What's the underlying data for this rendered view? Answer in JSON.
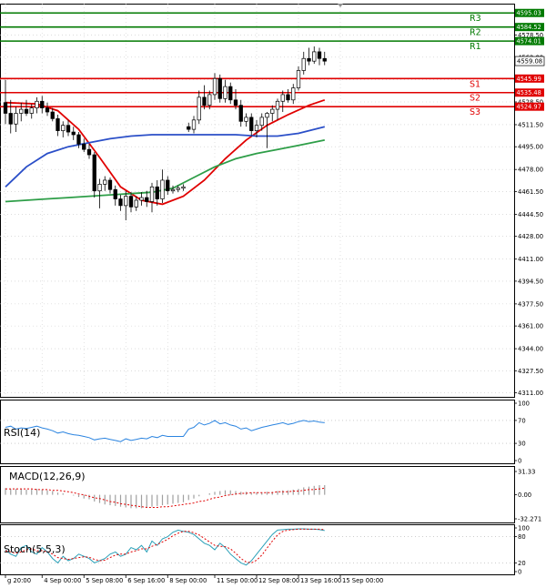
{
  "chart_data": {
    "type": "candlestick",
    "symbol": "",
    "grid": true,
    "price_axis": {
      "ylim": [
        4308,
        4602
      ],
      "ticks": [
        4311.0,
        4327.5,
        4344.0,
        4361.0,
        4377.5,
        4394.5,
        4411.0,
        4428.0,
        4444.5,
        4461.5,
        4478.0,
        4495.0,
        4511.5,
        4528.5,
        4545.0,
        4562.0,
        4578.5,
        4595.0
      ],
      "tick_labels": [
        "4311.00",
        "4327.50",
        "4344.00",
        "4361.00",
        "4377.50",
        "4394.50",
        "4411.00",
        "4428.00",
        "4444.50",
        "4461.50",
        "4478.00",
        "4495.00",
        "4511.50",
        "4528.50",
        "4545.00",
        "4562.00",
        "4578.50",
        "4595.00"
      ]
    },
    "time_axis": {
      "labels": [
        "g 20:00",
        "4 Sep 00:00",
        "5 Sep 08:00",
        "6 Sep 16:00",
        "8 Sep 00:00",
        "11 Sep 00:00",
        "12 Sep 08:00",
        "13 Sep 16:00",
        "15 Sep 00:00"
      ],
      "label_bars": [
        0,
        7,
        15,
        23,
        31,
        40,
        48,
        56,
        64
      ]
    },
    "levels": [
      {
        "name": "R3",
        "value": 4595.03,
        "label": "4595.03",
        "color": "#007a00"
      },
      {
        "name": "R2",
        "value": 4584.52,
        "label": "4584.52",
        "color": "#007a00"
      },
      {
        "name": "R1",
        "value": 4574.01,
        "label": "4574.01",
        "color": "#007a00"
      },
      {
        "name": "S1",
        "value": 4545.99,
        "label": "4545.99",
        "color": "#e00000"
      },
      {
        "name": "S2",
        "value": 4535.48,
        "label": "4535.48",
        "color": "#e00000"
      },
      {
        "name": "S3",
        "value": 4524.97,
        "label": "4524.97",
        "color": "#e00000"
      }
    ],
    "current_price": {
      "value": 4559.08,
      "label": "4559.08"
    },
    "candles": [
      {
        "o": 4528,
        "h": 4545,
        "l": 4512,
        "c": 4520
      },
      {
        "o": 4520,
        "h": 4530,
        "l": 4505,
        "c": 4512
      },
      {
        "o": 4512,
        "h": 4525,
        "l": 4506,
        "c": 4520
      },
      {
        "o": 4520,
        "h": 4528,
        "l": 4514,
        "c": 4523
      },
      {
        "o": 4523,
        "h": 4530,
        "l": 4518,
        "c": 4520
      },
      {
        "o": 4520,
        "h": 4527,
        "l": 4516,
        "c": 4524
      },
      {
        "o": 4524,
        "h": 4532,
        "l": 4520,
        "c": 4529
      },
      {
        "o": 4529,
        "h": 4533,
        "l": 4520,
        "c": 4524
      },
      {
        "o": 4524,
        "h": 4528,
        "l": 4518,
        "c": 4521
      },
      {
        "o": 4521,
        "h": 4524,
        "l": 4514,
        "c": 4516
      },
      {
        "o": 4516,
        "h": 4519,
        "l": 4503,
        "c": 4507
      },
      {
        "o": 4507,
        "h": 4514,
        "l": 4502,
        "c": 4511
      },
      {
        "o": 4511,
        "h": 4515,
        "l": 4503,
        "c": 4506
      },
      {
        "o": 4506,
        "h": 4510,
        "l": 4500,
        "c": 4504
      },
      {
        "o": 4504,
        "h": 4506,
        "l": 4494,
        "c": 4497
      },
      {
        "o": 4497,
        "h": 4501,
        "l": 4491,
        "c": 4493
      },
      {
        "o": 4493,
        "h": 4497,
        "l": 4486,
        "c": 4489
      },
      {
        "o": 4489,
        "h": 4491,
        "l": 4457,
        "c": 4462
      },
      {
        "o": 4462,
        "h": 4471,
        "l": 4449,
        "c": 4467
      },
      {
        "o": 4467,
        "h": 4473,
        "l": 4462,
        "c": 4470
      },
      {
        "o": 4470,
        "h": 4472,
        "l": 4460,
        "c": 4463
      },
      {
        "o": 4463,
        "h": 4466,
        "l": 4451,
        "c": 4456
      },
      {
        "o": 4456,
        "h": 4459,
        "l": 4447,
        "c": 4451
      },
      {
        "o": 4451,
        "h": 4462,
        "l": 4440,
        "c": 4458
      },
      {
        "o": 4458,
        "h": 4461,
        "l": 4446,
        "c": 4450
      },
      {
        "o": 4450,
        "h": 4458,
        "l": 4447,
        "c": 4455
      },
      {
        "o": 4455,
        "h": 4461,
        "l": 4451,
        "c": 4457
      },
      {
        "o": 4457,
        "h": 4462,
        "l": 4450,
        "c": 4454
      },
      {
        "o": 4454,
        "h": 4468,
        "l": 4446,
        "c": 4465
      },
      {
        "o": 4465,
        "h": 4470,
        "l": 4451,
        "c": 4456
      },
      {
        "o": 4456,
        "h": 4478,
        "l": 4453,
        "c": 4470
      },
      {
        "o": 4470,
        "h": 4473,
        "l": 4459,
        "c": 4462
      },
      {
        "o": 4462,
        "h": 4466,
        "l": 4460,
        "c": 4463
      },
      {
        "o": 4463,
        "h": 4466,
        "l": 4461,
        "c": 4464
      },
      {
        "o": 4464,
        "h": 4467,
        "l": 4462,
        "c": 4465
      },
      {
        "o": 4510,
        "h": 4513,
        "l": 4506,
        "c": 4508
      },
      {
        "o": 4508,
        "h": 4518,
        "l": 4505,
        "c": 4515
      },
      {
        "o": 4515,
        "h": 4537,
        "l": 4512,
        "c": 4532
      },
      {
        "o": 4532,
        "h": 4541,
        "l": 4523,
        "c": 4526
      },
      {
        "o": 4526,
        "h": 4537,
        "l": 4523,
        "c": 4534
      },
      {
        "o": 4534,
        "h": 4550,
        "l": 4530,
        "c": 4546
      },
      {
        "o": 4546,
        "h": 4549,
        "l": 4528,
        "c": 4531
      },
      {
        "o": 4531,
        "h": 4545,
        "l": 4528,
        "c": 4540
      },
      {
        "o": 4540,
        "h": 4543,
        "l": 4527,
        "c": 4530
      },
      {
        "o": 4530,
        "h": 4538,
        "l": 4523,
        "c": 4526
      },
      {
        "o": 4526,
        "h": 4530,
        "l": 4510,
        "c": 4514
      },
      {
        "o": 4514,
        "h": 4520,
        "l": 4510,
        "c": 4517
      },
      {
        "o": 4517,
        "h": 4520,
        "l": 4503,
        "c": 4507
      },
      {
        "o": 4507,
        "h": 4515,
        "l": 4502,
        "c": 4511
      },
      {
        "o": 4511,
        "h": 4520,
        "l": 4507,
        "c": 4517
      },
      {
        "o": 4517,
        "h": 4521,
        "l": 4494,
        "c": 4520
      },
      {
        "o": 4520,
        "h": 4526,
        "l": 4514,
        "c": 4523
      },
      {
        "o": 4523,
        "h": 4531,
        "l": 4515,
        "c": 4529
      },
      {
        "o": 4529,
        "h": 4537,
        "l": 4521,
        "c": 4534
      },
      {
        "o": 4534,
        "h": 4538,
        "l": 4528,
        "c": 4530
      },
      {
        "o": 4530,
        "h": 4542,
        "l": 4527,
        "c": 4539
      },
      {
        "o": 4539,
        "h": 4555,
        "l": 4537,
        "c": 4552
      },
      {
        "o": 4552,
        "h": 4566,
        "l": 4549,
        "c": 4561
      },
      {
        "o": 4561,
        "h": 4569,
        "l": 4556,
        "c": 4559
      },
      {
        "o": 4559,
        "h": 4570,
        "l": 4557,
        "c": 4566
      },
      {
        "o": 4566,
        "h": 4569,
        "l": 4556,
        "c": 4561
      },
      {
        "o": 4561,
        "h": 4566,
        "l": 4556,
        "c": 4559
      }
    ],
    "ma_series": [
      {
        "color": "#e00000",
        "points": [
          [
            0,
            4528
          ],
          [
            6,
            4527
          ],
          [
            10,
            4522
          ],
          [
            14,
            4508
          ],
          [
            18,
            4487
          ],
          [
            22,
            4465
          ],
          [
            26,
            4455
          ],
          [
            30,
            4452
          ],
          [
            34,
            4458
          ],
          [
            38,
            4470
          ],
          [
            42,
            4486
          ],
          [
            46,
            4500
          ],
          [
            50,
            4511
          ],
          [
            54,
            4519
          ],
          [
            58,
            4526
          ],
          [
            61,
            4530
          ]
        ]
      },
      {
        "color": "#2b4fc8",
        "points": [
          [
            0,
            4465
          ],
          [
            4,
            4480
          ],
          [
            8,
            4490
          ],
          [
            12,
            4495
          ],
          [
            16,
            4498
          ],
          [
            20,
            4501
          ],
          [
            24,
            4503
          ],
          [
            28,
            4504
          ],
          [
            32,
            4504
          ],
          [
            36,
            4504
          ],
          [
            40,
            4504
          ],
          [
            44,
            4504
          ],
          [
            48,
            4503
          ],
          [
            52,
            4503
          ],
          [
            56,
            4505
          ],
          [
            61,
            4510
          ]
        ]
      },
      {
        "color": "#2e9e48",
        "points": [
          [
            0,
            4454
          ],
          [
            4,
            4455
          ],
          [
            8,
            4456
          ],
          [
            12,
            4457
          ],
          [
            16,
            4458
          ],
          [
            20,
            4459
          ],
          [
            24,
            4460
          ],
          [
            28,
            4461
          ],
          [
            32,
            4464
          ],
          [
            36,
            4472
          ],
          [
            40,
            4480
          ],
          [
            44,
            4486
          ],
          [
            48,
            4490
          ],
          [
            52,
            4493
          ],
          [
            56,
            4496
          ],
          [
            61,
            4500
          ]
        ]
      }
    ],
    "indicators": {
      "rsi": {
        "label": "RSI(14)",
        "ticks": [
          100,
          70,
          30,
          0
        ],
        "tick_labels": [
          "100",
          "70",
          "30",
          "0"
        ],
        "values": [
          58,
          60,
          55,
          57,
          56,
          58,
          60,
          57,
          55,
          52,
          48,
          50,
          47,
          45,
          44,
          42,
          40,
          36,
          38,
          39,
          37,
          35,
          33,
          38,
          35,
          37,
          39,
          38,
          42,
          40,
          44,
          42,
          42,
          42,
          42,
          55,
          58,
          66,
          62,
          65,
          70,
          64,
          66,
          62,
          60,
          55,
          57,
          52,
          55,
          58,
          60,
          62,
          64,
          66,
          63,
          65,
          68,
          70,
          68,
          69,
          67,
          66
        ]
      },
      "macd": {
        "label": "MACD(12,26,9)",
        "ticks": [
          31.33,
          0.0,
          -32.271
        ],
        "tick_labels": [
          "31.33",
          "0.00",
          "-32.271"
        ],
        "histogram": [
          9,
          8,
          8,
          8,
          7,
          7,
          8,
          7,
          6,
          5,
          3,
          2,
          0,
          -1,
          -3,
          -5,
          -6,
          -9,
          -11,
          -13,
          -14,
          -15,
          -16,
          -17,
          -18,
          -18,
          -18,
          -17,
          -16,
          -15,
          -14,
          -13,
          -12,
          -11,
          -10,
          -7,
          -5,
          -2,
          0,
          2,
          4,
          5,
          6,
          6,
          5,
          4,
          4,
          3,
          3,
          3,
          4,
          4,
          5,
          6,
          6,
          7,
          8,
          10,
          11,
          12,
          13,
          13
        ],
        "signal": [
          8,
          8,
          8,
          8,
          8,
          8,
          7,
          7,
          7,
          6,
          6,
          5,
          4,
          3,
          1,
          0,
          -2,
          -4,
          -5,
          -7,
          -9,
          -10,
          -12,
          -13,
          -14,
          -15,
          -16,
          -17,
          -17,
          -17,
          -16,
          -16,
          -15,
          -14,
          -13,
          -12,
          -11,
          -9,
          -8,
          -6,
          -4,
          -3,
          -1,
          0,
          1,
          2,
          2,
          3,
          3,
          3,
          3,
          3,
          4,
          4,
          4,
          5,
          5,
          6,
          7,
          7,
          8,
          9
        ]
      },
      "stoch": {
        "label": "Stoch(5,5,3)",
        "ticks": [
          100,
          80,
          20,
          0
        ],
        "tick_labels": [
          "100",
          "80",
          "20",
          "0"
        ],
        "k": [
          50,
          40,
          35,
          55,
          60,
          45,
          40,
          55,
          45,
          30,
          20,
          35,
          25,
          30,
          40,
          35,
          30,
          20,
          25,
          30,
          40,
          45,
          35,
          40,
          55,
          50,
          60,
          45,
          70,
          60,
          75,
          80,
          90,
          95,
          92,
          90,
          85,
          75,
          65,
          60,
          50,
          65,
          55,
          40,
          30,
          20,
          15,
          25,
          40,
          55,
          70,
          85,
          95,
          96,
          97,
          97,
          98,
          98,
          97,
          97,
          96,
          94
        ],
        "d": [
          48,
          45,
          42,
          45,
          50,
          52,
          48,
          48,
          46,
          40,
          32,
          30,
          28,
          30,
          32,
          34,
          33,
          28,
          25,
          26,
          32,
          38,
          40,
          40,
          45,
          48,
          52,
          52,
          58,
          62,
          68,
          74,
          82,
          88,
          92,
          92,
          89,
          84,
          76,
          68,
          60,
          58,
          57,
          52,
          42,
          30,
          22,
          20,
          26,
          38,
          54,
          70,
          84,
          92,
          95,
          96,
          97,
          97,
          97,
          97,
          97,
          96
        ]
      }
    }
  }
}
